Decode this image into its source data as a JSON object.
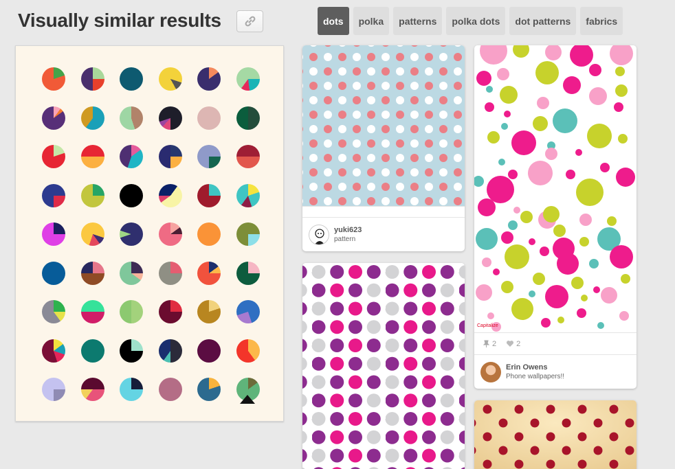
{
  "header": {
    "title": "Visually similar results"
  },
  "tags": [
    {
      "label": "dots",
      "active": true
    },
    {
      "label": "polka",
      "active": false
    },
    {
      "label": "patterns",
      "active": false
    },
    {
      "label": "polka dots",
      "active": false
    },
    {
      "label": "dot patterns",
      "active": false
    },
    {
      "label": "fabrics",
      "active": false
    }
  ],
  "pins": [
    {
      "user": "yuki623",
      "board": "pattern"
    },
    {
      "user": "",
      "board": ""
    },
    {
      "user": "Erin Owens",
      "board": "Phone wallpapers!!",
      "repins": "2",
      "likes": "2",
      "watermark": "Capitalize"
    },
    {
      "user": "",
      "board": ""
    }
  ],
  "icons": {
    "link": "link-icon",
    "repin": "pin-icon",
    "like": "heart-icon"
  }
}
